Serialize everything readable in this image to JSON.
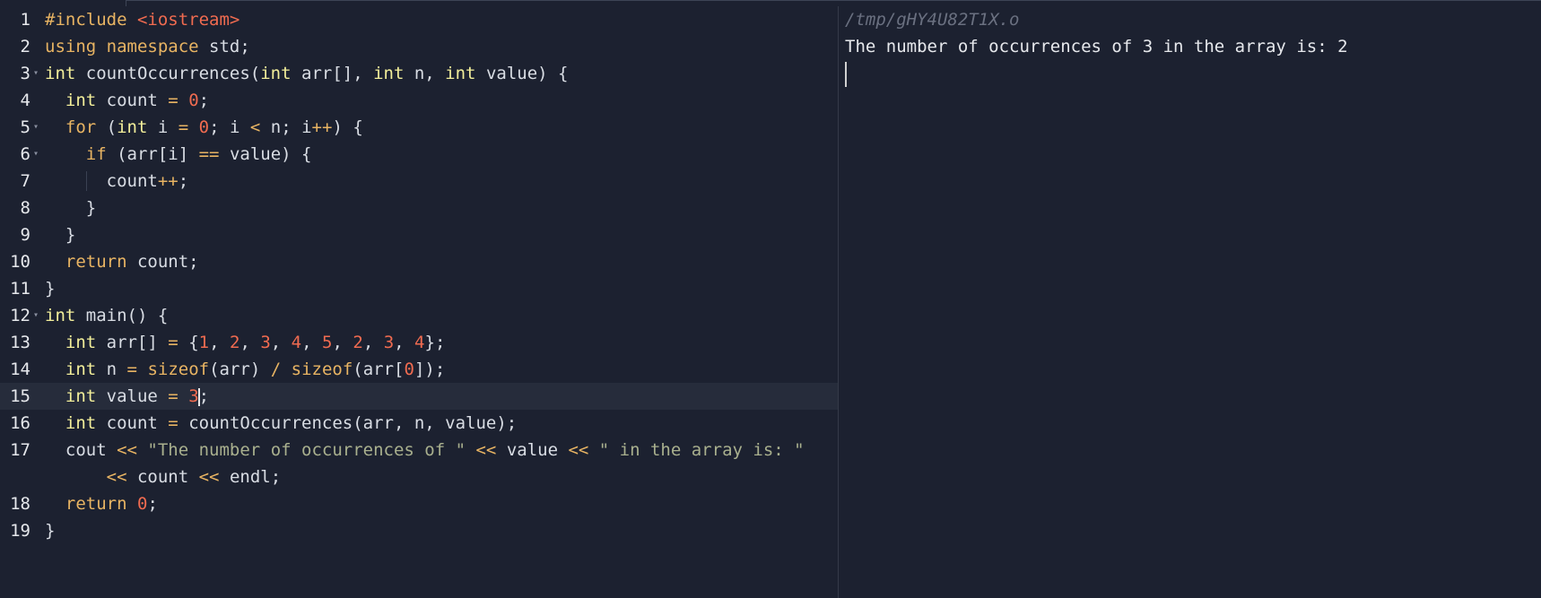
{
  "editor": {
    "lines": [
      {
        "no": "1",
        "fold": false,
        "active": false,
        "tokens": [
          {
            "t": "pp",
            "v": "#include "
          },
          {
            "t": "inc",
            "v": "<iostream>"
          }
        ]
      },
      {
        "no": "2",
        "fold": false,
        "active": false,
        "tokens": [
          {
            "t": "kw",
            "v": "using"
          },
          {
            "t": "",
            "v": " "
          },
          {
            "t": "kw",
            "v": "namespace"
          },
          {
            "t": "",
            "v": " std;"
          }
        ]
      },
      {
        "no": "3",
        "fold": true,
        "active": false,
        "tokens": [
          {
            "t": "ty",
            "v": "int"
          },
          {
            "t": "",
            "v": " countOccurrences("
          },
          {
            "t": "ty",
            "v": "int"
          },
          {
            "t": "",
            "v": " arr[], "
          },
          {
            "t": "ty",
            "v": "int"
          },
          {
            "t": "",
            "v": " n, "
          },
          {
            "t": "ty",
            "v": "int"
          },
          {
            "t": "",
            "v": " value) {"
          }
        ]
      },
      {
        "no": "4",
        "fold": false,
        "active": false,
        "tokens": [
          {
            "t": "",
            "v": "  "
          },
          {
            "t": "ty",
            "v": "int"
          },
          {
            "t": "",
            "v": " count "
          },
          {
            "t": "op",
            "v": "="
          },
          {
            "t": "",
            "v": " "
          },
          {
            "t": "num",
            "v": "0"
          },
          {
            "t": "",
            "v": ";"
          }
        ]
      },
      {
        "no": "5",
        "fold": true,
        "active": false,
        "tokens": [
          {
            "t": "",
            "v": "  "
          },
          {
            "t": "kw",
            "v": "for"
          },
          {
            "t": "",
            "v": " ("
          },
          {
            "t": "ty",
            "v": "int"
          },
          {
            "t": "",
            "v": " i "
          },
          {
            "t": "op",
            "v": "="
          },
          {
            "t": "",
            "v": " "
          },
          {
            "t": "num",
            "v": "0"
          },
          {
            "t": "",
            "v": "; i "
          },
          {
            "t": "op",
            "v": "<"
          },
          {
            "t": "",
            "v": " n; i"
          },
          {
            "t": "op",
            "v": "++"
          },
          {
            "t": "",
            "v": ") {"
          }
        ]
      },
      {
        "no": "6",
        "fold": true,
        "active": false,
        "tokens": [
          {
            "t": "",
            "v": "    "
          },
          {
            "t": "kw",
            "v": "if"
          },
          {
            "t": "",
            "v": " (arr[i] "
          },
          {
            "t": "op",
            "v": "=="
          },
          {
            "t": "",
            "v": " value) {"
          }
        ]
      },
      {
        "no": "7",
        "fold": false,
        "active": false,
        "guide": true,
        "tokens": [
          {
            "t": "",
            "v": "      count"
          },
          {
            "t": "op",
            "v": "++"
          },
          {
            "t": "",
            "v": ";"
          }
        ]
      },
      {
        "no": "8",
        "fold": false,
        "active": false,
        "tokens": [
          {
            "t": "",
            "v": "    }"
          }
        ]
      },
      {
        "no": "9",
        "fold": false,
        "active": false,
        "tokens": [
          {
            "t": "",
            "v": "  }"
          }
        ]
      },
      {
        "no": "10",
        "fold": false,
        "active": false,
        "tokens": [
          {
            "t": "",
            "v": "  "
          },
          {
            "t": "kw",
            "v": "return"
          },
          {
            "t": "",
            "v": " count;"
          }
        ]
      },
      {
        "no": "11",
        "fold": false,
        "active": false,
        "tokens": [
          {
            "t": "",
            "v": "}"
          }
        ]
      },
      {
        "no": "12",
        "fold": true,
        "active": false,
        "tokens": [
          {
            "t": "ty",
            "v": "int"
          },
          {
            "t": "",
            "v": " main() {"
          }
        ]
      },
      {
        "no": "13",
        "fold": false,
        "active": false,
        "tokens": [
          {
            "t": "",
            "v": "  "
          },
          {
            "t": "ty",
            "v": "int"
          },
          {
            "t": "",
            "v": " arr[] "
          },
          {
            "t": "op",
            "v": "="
          },
          {
            "t": "",
            "v": " {"
          },
          {
            "t": "num",
            "v": "1"
          },
          {
            "t": "",
            "v": ", "
          },
          {
            "t": "num",
            "v": "2"
          },
          {
            "t": "",
            "v": ", "
          },
          {
            "t": "num",
            "v": "3"
          },
          {
            "t": "",
            "v": ", "
          },
          {
            "t": "num",
            "v": "4"
          },
          {
            "t": "",
            "v": ", "
          },
          {
            "t": "num",
            "v": "5"
          },
          {
            "t": "",
            "v": ", "
          },
          {
            "t": "num",
            "v": "2"
          },
          {
            "t": "",
            "v": ", "
          },
          {
            "t": "num",
            "v": "3"
          },
          {
            "t": "",
            "v": ", "
          },
          {
            "t": "num",
            "v": "4"
          },
          {
            "t": "",
            "v": "};"
          }
        ]
      },
      {
        "no": "14",
        "fold": false,
        "active": false,
        "tokens": [
          {
            "t": "",
            "v": "  "
          },
          {
            "t": "ty",
            "v": "int"
          },
          {
            "t": "",
            "v": " n "
          },
          {
            "t": "op",
            "v": "="
          },
          {
            "t": "",
            "v": " "
          },
          {
            "t": "kw",
            "v": "sizeof"
          },
          {
            "t": "",
            "v": "(arr) "
          },
          {
            "t": "op",
            "v": "/"
          },
          {
            "t": "",
            "v": " "
          },
          {
            "t": "kw",
            "v": "sizeof"
          },
          {
            "t": "",
            "v": "(arr["
          },
          {
            "t": "num",
            "v": "0"
          },
          {
            "t": "",
            "v": "]);"
          }
        ]
      },
      {
        "no": "15",
        "fold": false,
        "active": true,
        "tokens": [
          {
            "t": "",
            "v": "  "
          },
          {
            "t": "ty",
            "v": "int"
          },
          {
            "t": "",
            "v": " value "
          },
          {
            "t": "op",
            "v": "="
          },
          {
            "t": "",
            "v": " "
          },
          {
            "t": "num",
            "v": "3"
          },
          {
            "t": "cursor",
            "v": ""
          },
          {
            "t": "",
            "v": ";"
          }
        ]
      },
      {
        "no": "16",
        "fold": false,
        "active": false,
        "tokens": [
          {
            "t": "",
            "v": "  "
          },
          {
            "t": "ty",
            "v": "int"
          },
          {
            "t": "",
            "v": " count "
          },
          {
            "t": "op",
            "v": "="
          },
          {
            "t": "",
            "v": " countOccurrences(arr, n, value);"
          }
        ]
      },
      {
        "no": "17",
        "fold": false,
        "active": false,
        "tokens": [
          {
            "t": "",
            "v": "  cout "
          },
          {
            "t": "op",
            "v": "<<"
          },
          {
            "t": "",
            "v": " "
          },
          {
            "t": "str",
            "v": "\"The number of occurrences of \""
          },
          {
            "t": "",
            "v": " "
          },
          {
            "t": "op",
            "v": "<<"
          },
          {
            "t": "",
            "v": " value "
          },
          {
            "t": "op",
            "v": "<<"
          },
          {
            "t": "",
            "v": " "
          },
          {
            "t": "str",
            "v": "\" in the array is: \""
          }
        ]
      },
      {
        "no": "",
        "fold": false,
        "active": false,
        "tokens": [
          {
            "t": "",
            "v": "      "
          },
          {
            "t": "op",
            "v": "<<"
          },
          {
            "t": "",
            "v": " count "
          },
          {
            "t": "op",
            "v": "<<"
          },
          {
            "t": "",
            "v": " endl;"
          }
        ]
      },
      {
        "no": "18",
        "fold": false,
        "active": false,
        "tokens": [
          {
            "t": "",
            "v": "  "
          },
          {
            "t": "kw",
            "v": "return"
          },
          {
            "t": "",
            "v": " "
          },
          {
            "t": "num",
            "v": "0"
          },
          {
            "t": "",
            "v": ";"
          }
        ]
      },
      {
        "no": "19",
        "fold": false,
        "active": false,
        "tokens": [
          {
            "t": "",
            "v": "}"
          }
        ]
      }
    ]
  },
  "terminal": {
    "path": "/tmp/gHY4U82T1X.o",
    "output": "The number of occurrences of 3 in the array is: 2"
  },
  "colors": {
    "background": "#1c2130",
    "keyword": "#e8b463",
    "type": "#f2ee9a",
    "number": "#f06b50",
    "string": "#a9b08e"
  }
}
